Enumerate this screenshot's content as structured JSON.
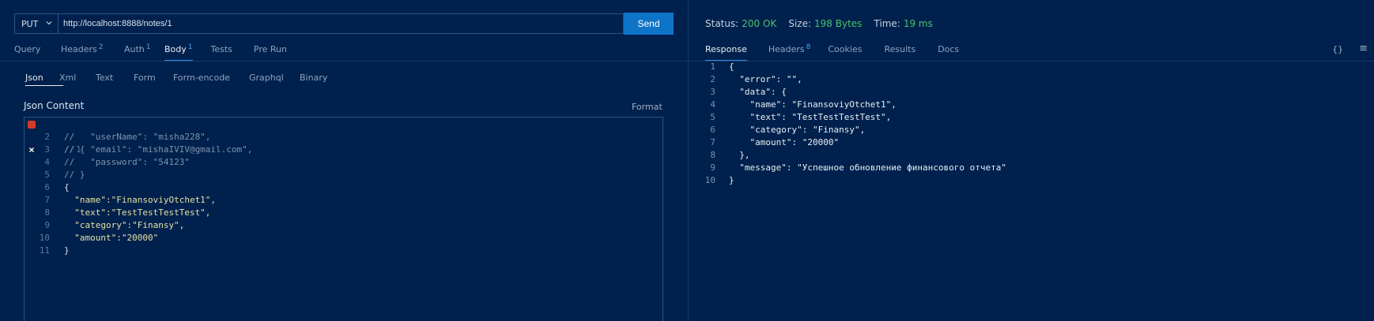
{
  "request": {
    "method": "PUT",
    "url": "http://localhost:8888/notes/1",
    "send_label": "Send"
  },
  "request_tabs": [
    {
      "label": "Query",
      "badge": ""
    },
    {
      "label": "Headers",
      "badge": "2"
    },
    {
      "label": "Auth",
      "badge": "1"
    },
    {
      "label": "Body",
      "badge": "1"
    },
    {
      "label": "Tests",
      "badge": ""
    },
    {
      "label": "Pre Run",
      "badge": ""
    }
  ],
  "active_request_tab": "Body",
  "body_tabs": [
    "Json",
    "Xml",
    "Text",
    "Form",
    "Form-encode",
    "Graphql",
    "Binary"
  ],
  "active_body_tab": "Json",
  "editor": {
    "title": "Json Content",
    "format_label": "Format",
    "lines": [
      {
        "n": "1",
        "text": "// {"
      },
      {
        "n": "2",
        "text": "//   \"userName\": \"misha228\","
      },
      {
        "n": "3",
        "text": "//   \"email\": \"mishaIVIV@gmail.com\","
      },
      {
        "n": "4",
        "text": "//   \"password\": \"54123\""
      },
      {
        "n": "5",
        "text": "// }"
      },
      {
        "n": "6",
        "text": "{"
      },
      {
        "n": "7",
        "text": "  \"name\":\"FinansoviyOtchet1\","
      },
      {
        "n": "8",
        "text": "  \"text\":\"TestTestTestTest\","
      },
      {
        "n": "9",
        "text": "  \"category\":\"Finansy\","
      },
      {
        "n": "10",
        "text": "  \"amount\":\"20000\""
      },
      {
        "n": "11",
        "text": "}"
      }
    ]
  },
  "status": {
    "status_label": "Status:",
    "status_value": "200 OK",
    "size_label": "Size:",
    "size_value": "198 Bytes",
    "time_label": "Time:",
    "time_value": "19 ms"
  },
  "response_tabs": [
    {
      "label": "Response",
      "badge": ""
    },
    {
      "label": "Headers",
      "badge": "8"
    },
    {
      "label": "Cookies",
      "badge": ""
    },
    {
      "label": "Results",
      "badge": ""
    },
    {
      "label": "Docs",
      "badge": ""
    }
  ],
  "active_response_tab": "Response",
  "response_icons": [
    "{}",
    "≡"
  ],
  "response_lines": [
    {
      "n": "1",
      "text": "{"
    },
    {
      "n": "2",
      "text": "  \"error\": \"\","
    },
    {
      "n": "3",
      "text": "  \"data\": {"
    },
    {
      "n": "4",
      "text": "    \"name\": \"FinansoviyOtchet1\","
    },
    {
      "n": "5",
      "text": "    \"text\": \"TestTestTestTest\","
    },
    {
      "n": "6",
      "text": "    \"category\": \"Finansy\","
    },
    {
      "n": "7",
      "text": "    \"amount\": \"20000\""
    },
    {
      "n": "8",
      "text": "  },"
    },
    {
      "n": "9",
      "text": "  \"message\": \"Успешное обновление финансового отчета\""
    },
    {
      "n": "10",
      "text": "}"
    }
  ],
  "colors": {
    "background": "#00214d",
    "accent": "#0e74c8",
    "success": "#4cc26c",
    "error": "#d33a2c"
  }
}
